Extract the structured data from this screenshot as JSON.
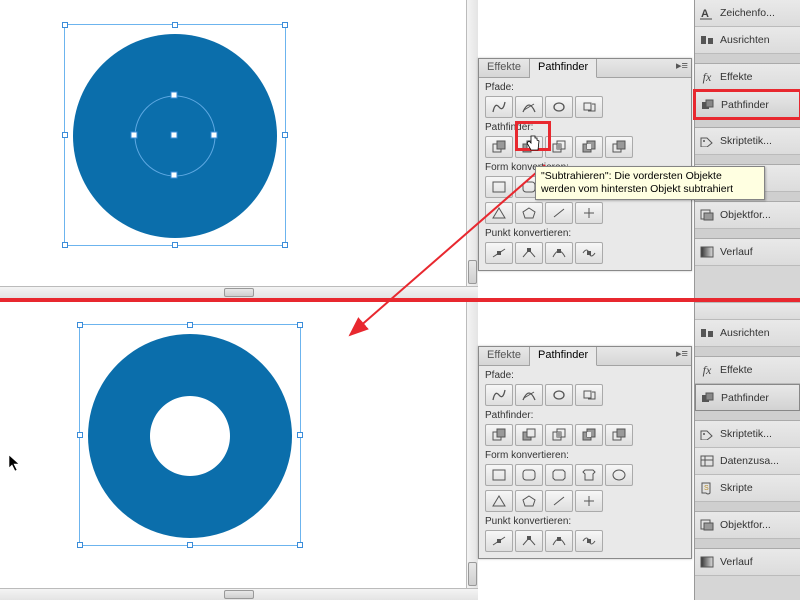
{
  "panel": {
    "tabs": {
      "effects": "Effekte",
      "pathfinder": "Pathfinder"
    },
    "sections": {
      "pfade": "Pfade:",
      "pathfinder": "Pathfinder:",
      "form": "Form konvertieren:",
      "punkt": "Punkt konvertieren:"
    },
    "tooltip": "\"Subtrahieren\": Die vordersten Objekte werden vom hintersten Objekt subtrahiert"
  },
  "side": {
    "zeichenfo": "Zeichenfo...",
    "ausrichten": "Ausrichten",
    "effekte": "Effekte",
    "pathfinder": "Pathfinder",
    "skriptetik": "Skriptetik...",
    "skripte": "Skripte",
    "objektfor": "Objektfor...",
    "verlauf": "Verlauf",
    "datenzusa": "Datenzusa..."
  },
  "colors": {
    "circle": "#0b6eab",
    "select": "#5da8e2",
    "red": "#e8282f"
  },
  "chart_data": {
    "type": "diagram",
    "top": {
      "shapes": [
        "large-circle-filled",
        "small-circle-outline-selected"
      ],
      "description": "Two concentric circles both selected, before Subtract"
    },
    "bottom": {
      "shapes": [
        "donut-filled"
      ],
      "description": "Resulting donut shape after Subtract pathfinder"
    },
    "operation": "Subtrahieren (Subtract)"
  }
}
